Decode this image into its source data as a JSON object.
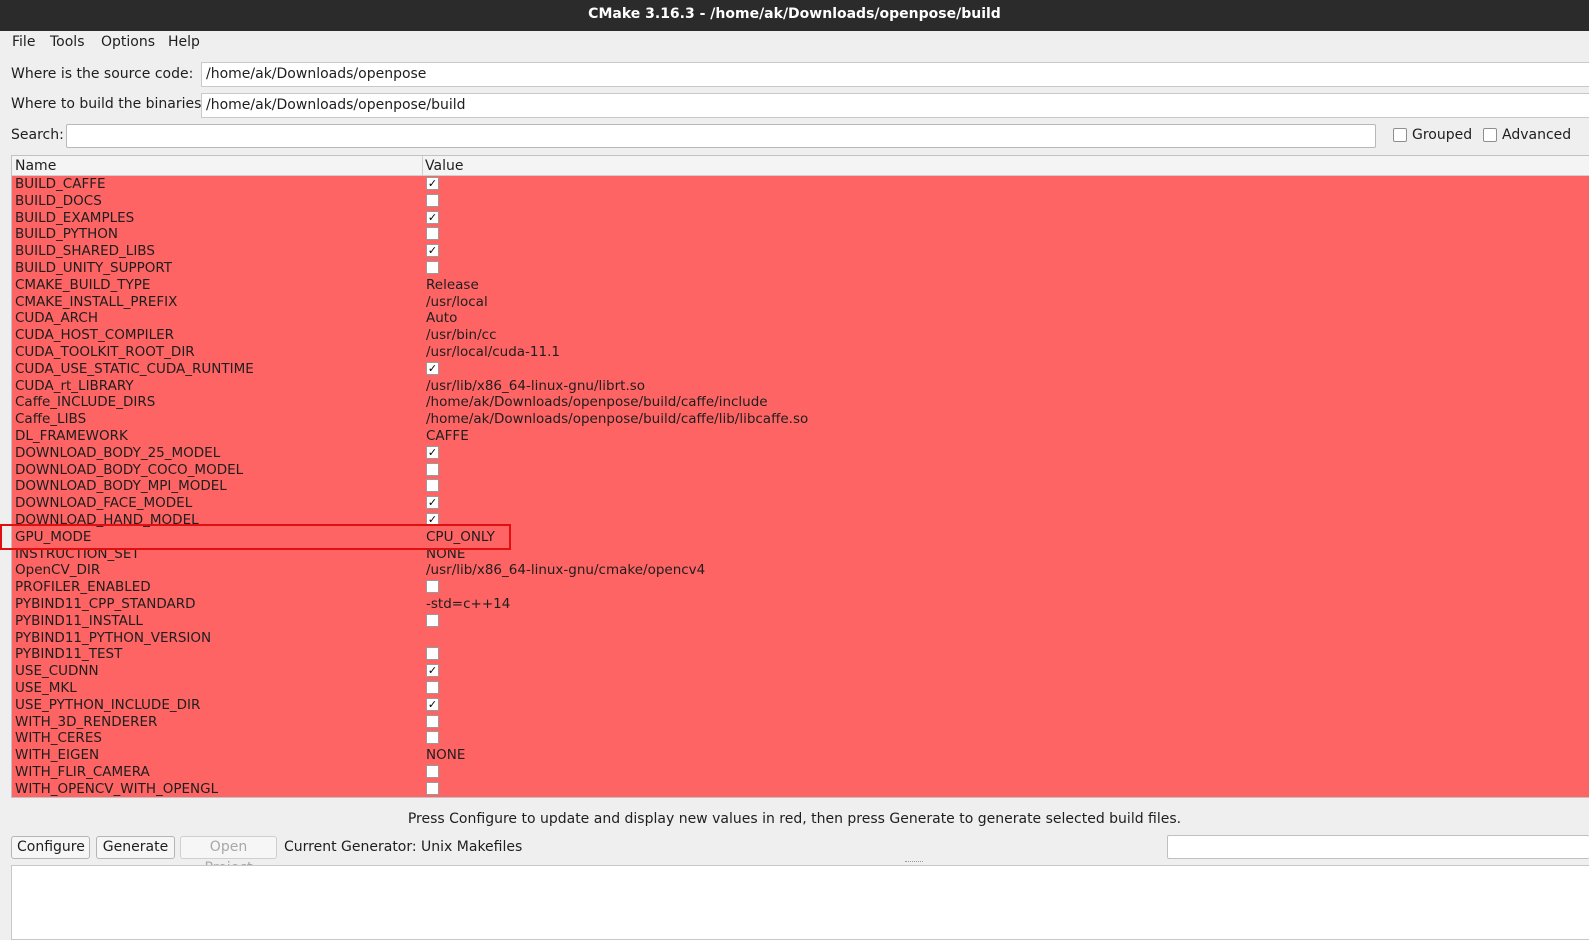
{
  "window": {
    "title": "CMake 3.16.3 - /home/ak/Downloads/openpose/build"
  },
  "menu": {
    "file": "File",
    "tools": "Tools",
    "options": "Options",
    "help": "Help"
  },
  "source": {
    "label": "Where is the source code:",
    "value": "/home/ak/Downloads/openpose"
  },
  "build": {
    "label": "Where to build the binaries:",
    "value": "/home/ak/Downloads/openpose/build"
  },
  "search": {
    "label": "Search:",
    "value": ""
  },
  "options": {
    "grouped": "Grouped",
    "advanced": "Advanced"
  },
  "table": {
    "headers": {
      "name": "Name",
      "value": "Value"
    },
    "row_color": "#ff6464",
    "rows": [
      {
        "name": "BUILD_CAFFE",
        "type": "bool",
        "checked": true,
        "value": ""
      },
      {
        "name": "BUILD_DOCS",
        "type": "bool",
        "checked": false,
        "value": ""
      },
      {
        "name": "BUILD_EXAMPLES",
        "type": "bool",
        "checked": true,
        "value": ""
      },
      {
        "name": "BUILD_PYTHON",
        "type": "bool",
        "checked": false,
        "value": ""
      },
      {
        "name": "BUILD_SHARED_LIBS",
        "type": "bool",
        "checked": true,
        "value": ""
      },
      {
        "name": "BUILD_UNITY_SUPPORT",
        "type": "bool",
        "checked": false,
        "value": ""
      },
      {
        "name": "CMAKE_BUILD_TYPE",
        "type": "text",
        "checked": false,
        "value": "Release"
      },
      {
        "name": "CMAKE_INSTALL_PREFIX",
        "type": "text",
        "checked": false,
        "value": "/usr/local"
      },
      {
        "name": "CUDA_ARCH",
        "type": "text",
        "checked": false,
        "value": "Auto"
      },
      {
        "name": "CUDA_HOST_COMPILER",
        "type": "text",
        "checked": false,
        "value": "/usr/bin/cc"
      },
      {
        "name": "CUDA_TOOLKIT_ROOT_DIR",
        "type": "text",
        "checked": false,
        "value": "/usr/local/cuda-11.1"
      },
      {
        "name": "CUDA_USE_STATIC_CUDA_RUNTIME",
        "type": "bool",
        "checked": true,
        "value": ""
      },
      {
        "name": "CUDA_rt_LIBRARY",
        "type": "text",
        "checked": false,
        "value": "/usr/lib/x86_64-linux-gnu/librt.so"
      },
      {
        "name": "Caffe_INCLUDE_DIRS",
        "type": "text",
        "checked": false,
        "value": "/home/ak/Downloads/openpose/build/caffe/include"
      },
      {
        "name": "Caffe_LIBS",
        "type": "text",
        "checked": false,
        "value": "/home/ak/Downloads/openpose/build/caffe/lib/libcaffe.so"
      },
      {
        "name": "DL_FRAMEWORK",
        "type": "text",
        "checked": false,
        "value": "CAFFE"
      },
      {
        "name": "DOWNLOAD_BODY_25_MODEL",
        "type": "bool",
        "checked": true,
        "value": ""
      },
      {
        "name": "DOWNLOAD_BODY_COCO_MODEL",
        "type": "bool",
        "checked": false,
        "value": ""
      },
      {
        "name": "DOWNLOAD_BODY_MPI_MODEL",
        "type": "bool",
        "checked": false,
        "value": ""
      },
      {
        "name": "DOWNLOAD_FACE_MODEL",
        "type": "bool",
        "checked": true,
        "value": ""
      },
      {
        "name": "DOWNLOAD_HAND_MODEL",
        "type": "bool",
        "checked": true,
        "value": ""
      },
      {
        "name": "GPU_MODE",
        "type": "text",
        "checked": false,
        "value": "CPU_ONLY"
      },
      {
        "name": "INSTRUCTION_SET",
        "type": "text",
        "checked": false,
        "value": "NONE"
      },
      {
        "name": "OpenCV_DIR",
        "type": "text",
        "checked": false,
        "value": "/usr/lib/x86_64-linux-gnu/cmake/opencv4"
      },
      {
        "name": "PROFILER_ENABLED",
        "type": "bool",
        "checked": false,
        "value": ""
      },
      {
        "name": "PYBIND11_CPP_STANDARD",
        "type": "text",
        "checked": false,
        "value": "-std=c++14"
      },
      {
        "name": "PYBIND11_INSTALL",
        "type": "bool",
        "checked": false,
        "value": ""
      },
      {
        "name": "PYBIND11_PYTHON_VERSION",
        "type": "text",
        "checked": false,
        "value": ""
      },
      {
        "name": "PYBIND11_TEST",
        "type": "bool",
        "checked": false,
        "value": ""
      },
      {
        "name": "USE_CUDNN",
        "type": "bool",
        "checked": true,
        "value": ""
      },
      {
        "name": "USE_MKL",
        "type": "bool",
        "checked": false,
        "value": ""
      },
      {
        "name": "USE_PYTHON_INCLUDE_DIR",
        "type": "bool",
        "checked": true,
        "value": ""
      },
      {
        "name": "WITH_3D_RENDERER",
        "type": "bool",
        "checked": false,
        "value": ""
      },
      {
        "name": "WITH_CERES",
        "type": "bool",
        "checked": false,
        "value": ""
      },
      {
        "name": "WITH_EIGEN",
        "type": "text",
        "checked": false,
        "value": "NONE"
      },
      {
        "name": "WITH_FLIR_CAMERA",
        "type": "bool",
        "checked": false,
        "value": ""
      },
      {
        "name": "WITH_OPENCV_WITH_OPENGL",
        "type": "bool",
        "checked": false,
        "value": ""
      }
    ]
  },
  "status_message": "Press Configure to update and display new values in red, then press Generate to generate selected build files.",
  "buttons": {
    "configure": "Configure",
    "generate": "Generate",
    "open_project": "Open Project"
  },
  "generator": "Current Generator: Unix Makefiles",
  "check_glyph": "✓",
  "highlight_color": "#e01010"
}
